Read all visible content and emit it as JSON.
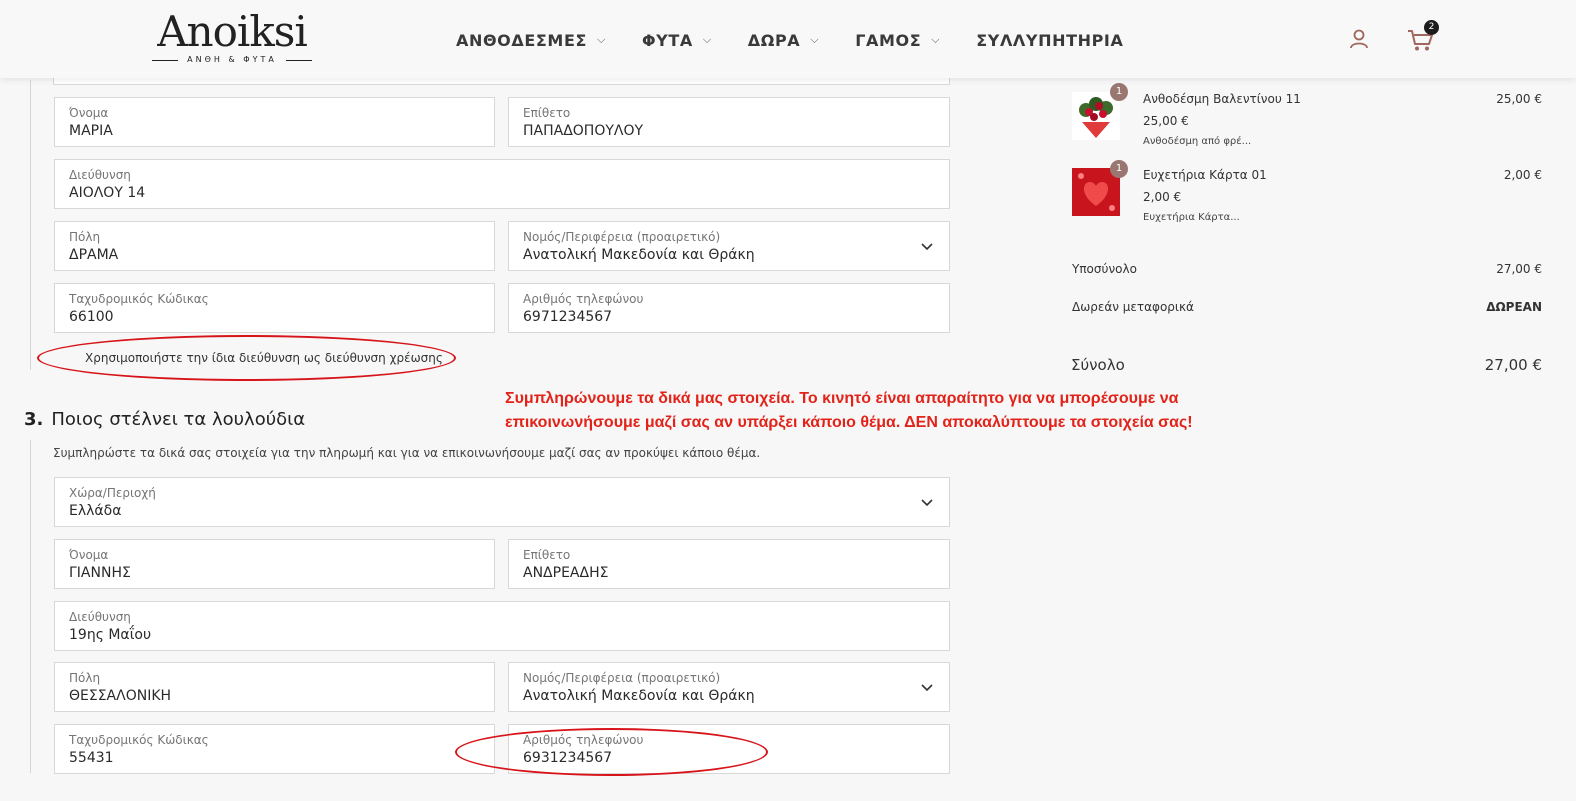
{
  "header": {
    "logo_main": "Anoiksi",
    "logo_sub": "ΑΝΘΗ & ΦΥΤΑ",
    "nav": [
      {
        "label": "ΑΝΘΟΔΕΣΜΕΣ",
        "has_dropdown": true
      },
      {
        "label": "ΦΥΤΑ",
        "has_dropdown": true
      },
      {
        "label": "ΔΩΡΑ",
        "has_dropdown": true
      },
      {
        "label": "ΓΑΜΟΣ",
        "has_dropdown": true
      },
      {
        "label": "ΣΥΛΛΥΠΗΤΗΡΙΑ",
        "has_dropdown": false
      }
    ],
    "cart_count": "2",
    "icons": [
      "user-icon",
      "cart-icon",
      "chevron-down-icon"
    ]
  },
  "shipping": {
    "first_name_label": "Όνομα",
    "first_name": "ΜΑΡΙΑ",
    "last_name_label": "Επίθετο",
    "last_name": "ΠΑΠΑΔΟΠΟΥΛΟΥ",
    "address_label": "Διεύθυνση",
    "address": "ΑΙΟΛΟΥ 14",
    "city_label": "Πόλη",
    "city": "ΔΡΑΜΑ",
    "region_label": "Νομός/Περιφέρεια (προαιρετικό)",
    "region": "Ανατολική Μακεδονία και Θράκη",
    "postcode_label": "Ταχυδρομικός Κώδικας",
    "postcode": "66100",
    "phone_label": "Αριθμός τηλεφώνου",
    "phone": "6971234567",
    "same_address_text": "Χρησιμοποιήστε την ίδια διεύθυνση ως διεύθυνση χρέωσης"
  },
  "sender": {
    "step_number": "3.",
    "title": "Ποιος στέλνει τα λουλούδια",
    "description": "Συμπληρώστε τα δικά σας στοιχεία για την πληρωμή και για να επικοινωνήσουμε μαζί σας αν προκύψει κάποιο θέμα.",
    "country_label": "Χώρα/Περιοχή",
    "country": "Ελλάδα",
    "first_name_label": "Όνομα",
    "first_name": "ΓΙΑΝΝΗΣ",
    "last_name_label": "Επίθετο",
    "last_name": "ΑΝΔΡΕΑΔΗΣ",
    "address_label": "Διεύθυνση",
    "address": "19ης Μαΐου",
    "city_label": "Πόλη",
    "city": "ΘΕΣΣΑΛΟΝΙΚΗ",
    "region_label": "Νομός/Περιφέρεια (προαιρετικό)",
    "region": "Ανατολική Μακεδονία και Θράκη",
    "postcode_label": "Ταχυδρομικός Κώδικας",
    "postcode": "55431",
    "phone_label": "Αριθμός τηλεφώνου",
    "phone": "6931234567"
  },
  "annotation": {
    "line1": "Συμπληρώνουμε τα δικά μας στοιχεία. Το κινητό είναι απαραίτητο για να μπορέσουμε να",
    "line2": "επικοινωνήσουμε μαζί σας αν υπάρξει κάποιο θέμα. ΔΕΝ αποκαλύπτουμε τα στοιχεία σας!",
    "color": "#e2231a"
  },
  "order": {
    "items": [
      {
        "qty": "1",
        "name": "Ανθοδέσμη Βαλεντίνου 11",
        "unit_price": "25,00 €",
        "description": "Ανθοδέσμη από φρέ...",
        "total": "25,00 €"
      },
      {
        "qty": "1",
        "name": "Ευχετήρια Κάρτα 01",
        "unit_price": "2,00 €",
        "description": "Ευχετήρια Κάρτα...",
        "total": "2,00 €"
      }
    ],
    "subtotal_label": "Υποσύνολο",
    "subtotal": "27,00 €",
    "shipping_label": "Δωρεάν μεταφορικά",
    "shipping": "ΔΩΡΕΑΝ",
    "total_label": "Σύνολο",
    "total": "27,00 €"
  }
}
